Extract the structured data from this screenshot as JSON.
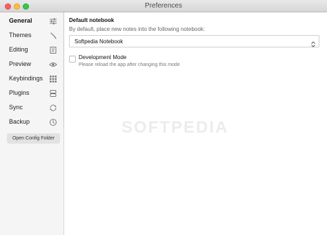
{
  "window": {
    "title": "Preferences"
  },
  "sidebar": {
    "items": [
      {
        "label": "General",
        "icon": "sliders-icon",
        "active": true
      },
      {
        "label": "Themes",
        "icon": "brush-icon"
      },
      {
        "label": "Editing",
        "icon": "edit-doc-icon"
      },
      {
        "label": "Preview",
        "icon": "eye-icon"
      },
      {
        "label": "Keybindings",
        "icon": "keyboard-grid-icon"
      },
      {
        "label": "Plugins",
        "icon": "plug-icon"
      },
      {
        "label": "Sync",
        "icon": "sync-icon"
      },
      {
        "label": "Backup",
        "icon": "clock-icon"
      }
    ],
    "config_button": "Open Config Folder"
  },
  "main": {
    "default_notebook": {
      "title": "Default notebook",
      "description": "By default, place new notes into the following notebook:",
      "selected": "Softpedia Notebook"
    },
    "dev_mode": {
      "label": "Development Mode",
      "description": "Please reload the app after changing this mode",
      "checked": false
    }
  },
  "watermark": "SOFTPEDIA",
  "colors": {
    "close": "#fc605c",
    "minimize": "#fdbc40",
    "maximize": "#34c84a"
  }
}
